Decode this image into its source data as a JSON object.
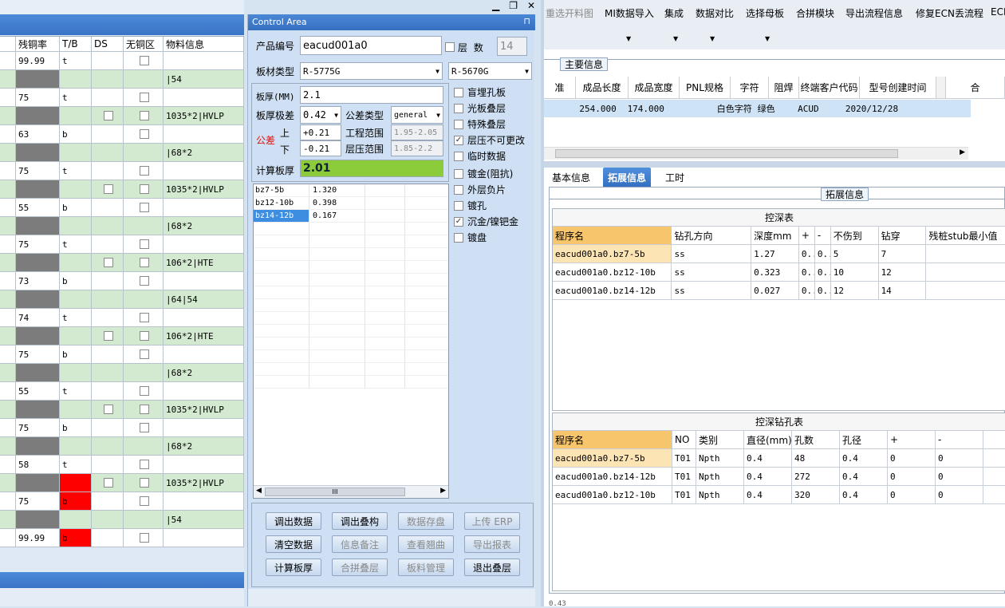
{
  "left": {
    "headers": [
      "",
      "残铜率",
      "T/B",
      "DS",
      "无铜区",
      "物料信息"
    ],
    "rows": [
      {
        "rate": "99.99",
        "tb": "t",
        "ds": false,
        "nocu": true,
        "material": "",
        "style": "white"
      },
      {
        "rate": "",
        "tb": "",
        "ds": false,
        "nocu": false,
        "material": "|54",
        "style": "green"
      },
      {
        "rate": "75",
        "tb": "t",
        "ds": false,
        "nocu": true,
        "material": "",
        "style": "white"
      },
      {
        "rate": "",
        "tb": "",
        "ds": true,
        "nocu": true,
        "material": "1035*2|HVLP",
        "style": "green"
      },
      {
        "rate": "63",
        "tb": "b",
        "ds": false,
        "nocu": true,
        "material": "",
        "style": "white"
      },
      {
        "rate": "",
        "tb": "",
        "ds": false,
        "nocu": false,
        "material": "|68*2",
        "style": "green"
      },
      {
        "rate": "75",
        "tb": "t",
        "ds": false,
        "nocu": true,
        "material": "",
        "style": "white"
      },
      {
        "rate": "",
        "tb": "",
        "ds": true,
        "nocu": true,
        "material": "1035*2|HVLP",
        "style": "green"
      },
      {
        "rate": "55",
        "tb": "b",
        "ds": false,
        "nocu": true,
        "material": "",
        "style": "white"
      },
      {
        "rate": "",
        "tb": "",
        "ds": false,
        "nocu": false,
        "material": "|68*2",
        "style": "green"
      },
      {
        "rate": "75",
        "tb": "t",
        "ds": false,
        "nocu": true,
        "material": "",
        "style": "white"
      },
      {
        "rate": "",
        "tb": "",
        "ds": true,
        "nocu": true,
        "material": "106*2|HTE",
        "style": "green"
      },
      {
        "rate": "73",
        "tb": "b",
        "ds": false,
        "nocu": true,
        "material": "",
        "style": "white"
      },
      {
        "rate": "",
        "tb": "",
        "ds": false,
        "nocu": false,
        "material": "|64|54",
        "style": "green"
      },
      {
        "rate": "74",
        "tb": "t",
        "ds": false,
        "nocu": true,
        "material": "",
        "style": "white"
      },
      {
        "rate": "",
        "tb": "",
        "ds": true,
        "nocu": true,
        "material": "106*2|HTE",
        "style": "green"
      },
      {
        "rate": "75",
        "tb": "b",
        "ds": false,
        "nocu": true,
        "material": "",
        "style": "white"
      },
      {
        "rate": "",
        "tb": "",
        "ds": false,
        "nocu": false,
        "material": "|68*2",
        "style": "green"
      },
      {
        "rate": "55",
        "tb": "t",
        "ds": false,
        "nocu": true,
        "material": "",
        "style": "white"
      },
      {
        "rate": "",
        "tb": "",
        "ds": true,
        "nocu": true,
        "material": "1035*2|HVLP",
        "style": "green"
      },
      {
        "rate": "75",
        "tb": "b",
        "ds": false,
        "nocu": true,
        "material": "",
        "style": "white"
      },
      {
        "rate": "",
        "tb": "",
        "ds": false,
        "nocu": false,
        "material": "|68*2",
        "style": "green"
      },
      {
        "rate": "58",
        "tb": "t",
        "ds": false,
        "nocu": true,
        "material": "",
        "style": "white"
      },
      {
        "rate": "",
        "tb": "",
        "ds": true,
        "nocu": true,
        "material": "1035*2|HVLP",
        "style": "green",
        "tbRed": true
      },
      {
        "rate": "75",
        "tb": "b",
        "ds": false,
        "nocu": true,
        "material": "",
        "style": "white",
        "tbRed": true
      },
      {
        "rate": "",
        "tb": "",
        "ds": false,
        "nocu": false,
        "material": "|54",
        "style": "green"
      },
      {
        "rate": "99.99",
        "tb": "b",
        "ds": false,
        "nocu": true,
        "material": "",
        "style": "white",
        "tbRed": true
      }
    ]
  },
  "control": {
    "title": "Control Area",
    "product_label": "产品编号",
    "product_value": "eacud001a0",
    "layer_label": "层 数",
    "layer_value": "14",
    "board_type_label": "板材类型",
    "board_type_1": "R-5775G",
    "board_type_2": "R-5670G",
    "thickness_label": "板厚(MM)",
    "thickness_value": "2.1",
    "tol_pole_label": "板厚极差",
    "tol_pole_value": "0.42",
    "tol_type_label": "公差类型",
    "tol_type_value": "general",
    "tol_label": "公差",
    "upper_label": "上",
    "lower_label": "下",
    "upper_value": "+0.21",
    "lower_value": "-0.21",
    "eng_range_label": "工程范围",
    "eng_range_value": "1.95-2.05",
    "press_range_label": "层压范围",
    "press_range_value": "1.85-2.2",
    "calc_label": "计算板厚",
    "calc_value": "2.01",
    "list": [
      {
        "name": "bz7-5b",
        "value": "1.320"
      },
      {
        "name": "bz12-10b",
        "value": "0.398"
      },
      {
        "name": "bz14-12b",
        "value": "0.167"
      }
    ],
    "scroll_mark": "III",
    "options": [
      {
        "label": "盲埋孔板",
        "checked": false
      },
      {
        "label": "光板叠层",
        "checked": false
      },
      {
        "label": "特殊叠层",
        "checked": false
      },
      {
        "label": "层压不可更改",
        "checked": true
      },
      {
        "label": "临时数据",
        "checked": false
      },
      {
        "label": "镀金(阻抗)",
        "checked": false
      },
      {
        "label": "外层负片",
        "checked": false
      },
      {
        "label": "镀孔",
        "checked": false
      },
      {
        "label": "沉金/镍钯金",
        "checked": true
      },
      {
        "label": "镀盘",
        "checked": false
      }
    ],
    "buttons": [
      {
        "label": "调出数据",
        "enabled": true
      },
      {
        "label": "调出叠构",
        "enabled": true
      },
      {
        "label": "数据存盘",
        "enabled": false
      },
      {
        "label": "上传 ERP",
        "enabled": false
      },
      {
        "label": "清空数据",
        "enabled": true
      },
      {
        "label": "信息备注",
        "enabled": false
      },
      {
        "label": "查看翘曲",
        "enabled": false
      },
      {
        "label": "导出报表",
        "enabled": false
      },
      {
        "label": "计算板厚",
        "enabled": true
      },
      {
        "label": "合拼叠层",
        "enabled": false
      },
      {
        "label": "板料管理",
        "enabled": false
      },
      {
        "label": "退出叠层",
        "enabled": true
      }
    ]
  },
  "toolbar": {
    "items": [
      "重选开料图",
      "MI数据导入",
      "集成",
      "数据对比",
      "选择母板",
      "合拼模块",
      "导出流程信息",
      "修复ECN丢流程",
      "ECN"
    ]
  },
  "main_info": {
    "title": "主要信息",
    "headers": [
      "准",
      "成品长度",
      "成品宽度",
      "PNL规格",
      "字符",
      "阻焊",
      "终端客户代码",
      "型号创建时间",
      "",
      "合"
    ],
    "row": [
      "",
      "254.000",
      "174.000",
      "",
      "白色字符",
      "绿色",
      "ACUD",
      "2020/12/28",
      "",
      ""
    ]
  },
  "tabs": [
    "基本信息",
    "拓展信息",
    "工时"
  ],
  "ext_title": "拓展信息",
  "depth_table": {
    "title": "控深表",
    "headers": [
      "程序名",
      "钻孔方向",
      "深度mm",
      "+",
      "-",
      "不伤到",
      "钻穿",
      "残桩stub最小值"
    ],
    "rows": [
      [
        "eacud001a0.bz7-5b",
        "ss",
        "1.27",
        "0..",
        "0..",
        "5",
        "7",
        ""
      ],
      [
        "eacud001a0.bz12-10b",
        "ss",
        "0.323",
        "0..",
        "0..",
        "10",
        "12",
        ""
      ],
      [
        "eacud001a0.bz14-12b",
        "ss",
        "0.027",
        "0..",
        "0..",
        "12",
        "14",
        ""
      ]
    ]
  },
  "hole_table": {
    "title": "控深钻孔表",
    "headers": [
      "程序名",
      "NO",
      "类别",
      "直径(mm)",
      "孔数",
      "孔径",
      "+",
      "-"
    ],
    "rows": [
      [
        "eacud001a0.bz7-5b",
        "T01",
        "Npth",
        "0.4",
        "48",
        "0.4",
        "0",
        "0"
      ],
      [
        "eacud001a0.bz14-12b",
        "T01",
        "Npth",
        "0.4",
        "272",
        "0.4",
        "0",
        "0"
      ],
      [
        "eacud001a0.bz12-10b",
        "T01",
        "Npth",
        "0.4",
        "320",
        "0.4",
        "0",
        "0"
      ]
    ]
  },
  "status": "0.43"
}
